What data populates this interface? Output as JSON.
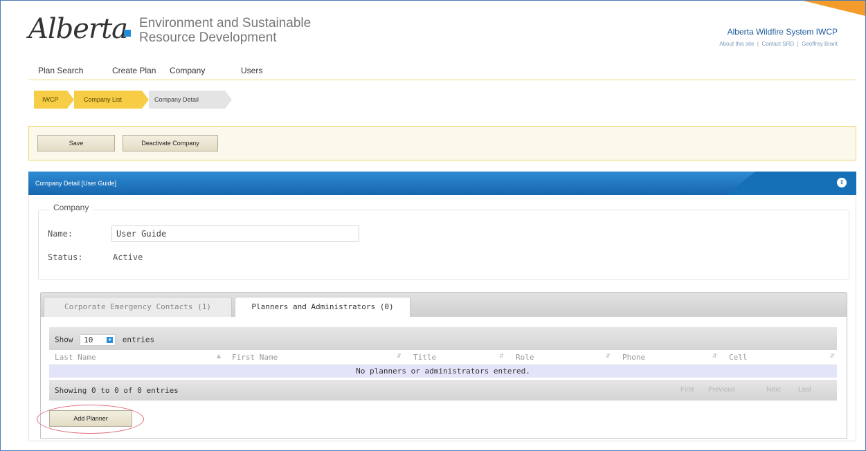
{
  "header": {
    "logo_text": "Alberta",
    "dept_line1": "Environment and Sustainable",
    "dept_line2": "Resource Development",
    "system_name": "Alberta Wildfire System IWCP",
    "links": [
      "About this site",
      "Contact SRD",
      "Geoffrey Brant"
    ],
    "link_separator": "|"
  },
  "nav": {
    "items": [
      "Plan Search",
      "Create Plan",
      "Company",
      "Users"
    ]
  },
  "breadcrumb": [
    "IWCP",
    "Company List",
    "Company Detail"
  ],
  "toolbar": {
    "save_label": "Save",
    "deactivate_label": "Deactivate Company"
  },
  "panel": {
    "title": "Company Detail [User Guide]",
    "toggle_icon": "circle-toggle-icon"
  },
  "company": {
    "legend": "Company",
    "name_label": "Name:",
    "name_value": "User Guide",
    "status_label": "Status:",
    "status_value": "Active"
  },
  "tabs": [
    {
      "label": "Corporate Emergency Contacts (1)",
      "active": false
    },
    {
      "label": "Planners and Administrators (0)",
      "active": true
    }
  ],
  "table": {
    "show_label": "Show",
    "page_size": "10",
    "entries_label": "entries",
    "columns": [
      "Last Name",
      "First Name",
      "Title",
      "Role",
      "Phone",
      "Cell"
    ],
    "empty_message": "No planners or administrators entered.",
    "info": "Showing 0 to 0 of 0 entries",
    "pagination": [
      "First",
      "Previous",
      "Next",
      "Last"
    ]
  },
  "actions": {
    "add_planner_label": "Add Planner"
  },
  "colors": {
    "accent_blue": "#1670b8",
    "breadcrumb_yellow": "#f6cd45",
    "toolbar_border": "#f0d56c",
    "highlight_red": "#e06b7a"
  }
}
